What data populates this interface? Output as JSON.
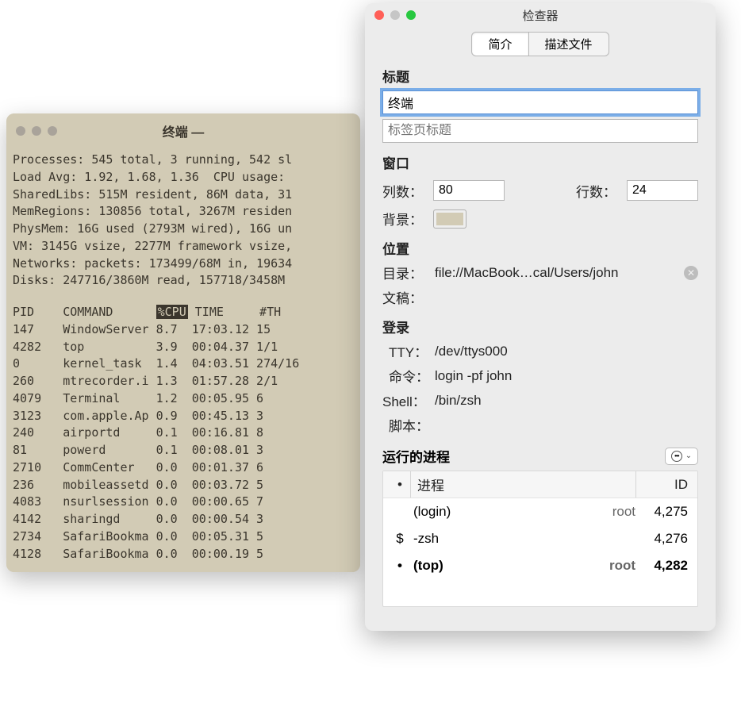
{
  "terminal": {
    "title": "终端 —",
    "stats": [
      "Processes: 545 total, 3 running, 542 sl",
      "Load Avg: 1.92, 1.68, 1.36  CPU usage: ",
      "SharedLibs: 515M resident, 86M data, 31",
      "MemRegions: 130856 total, 3267M residen",
      "PhysMem: 16G used (2793M wired), 16G un",
      "VM: 3145G vsize, 2277M framework vsize,",
      "Networks: packets: 173499/68M in, 19634",
      "Disks: 247716/3860M read, 157718/3458M "
    ],
    "columns": {
      "pid": "PID",
      "command": "COMMAND",
      "cpu": "%CPU",
      "time": "TIME",
      "th": "#TH"
    },
    "rows": [
      {
        "pid": "147",
        "cmd": "WindowServer",
        "cpu": "8.7",
        "time": "17:03.12",
        "th": "15"
      },
      {
        "pid": "4282",
        "cmd": "top",
        "cpu": "3.9",
        "time": "00:04.37",
        "th": "1/1"
      },
      {
        "pid": "0",
        "cmd": "kernel_task",
        "cpu": "1.4",
        "time": "04:03.51",
        "th": "274/16"
      },
      {
        "pid": "260",
        "cmd": "mtrecorder.i",
        "cpu": "1.3",
        "time": "01:57.28",
        "th": "2/1"
      },
      {
        "pid": "4079",
        "cmd": "Terminal",
        "cpu": "1.2",
        "time": "00:05.95",
        "th": "6"
      },
      {
        "pid": "3123",
        "cmd": "com.apple.Ap",
        "cpu": "0.9",
        "time": "00:45.13",
        "th": "3"
      },
      {
        "pid": "240",
        "cmd": "airportd",
        "cpu": "0.1",
        "time": "00:16.81",
        "th": "8"
      },
      {
        "pid": "81",
        "cmd": "powerd",
        "cpu": "0.1",
        "time": "00:08.01",
        "th": "3"
      },
      {
        "pid": "2710",
        "cmd": "CommCenter",
        "cpu": "0.0",
        "time": "00:01.37",
        "th": "6"
      },
      {
        "pid": "236",
        "cmd": "mobileassetd",
        "cpu": "0.0",
        "time": "00:03.72",
        "th": "5"
      },
      {
        "pid": "4083",
        "cmd": "nsurlsession",
        "cpu": "0.0",
        "time": "00:00.65",
        "th": "7"
      },
      {
        "pid": "4142",
        "cmd": "sharingd",
        "cpu": "0.0",
        "time": "00:00.54",
        "th": "3"
      },
      {
        "pid": "2734",
        "cmd": "SafariBookma",
        "cpu": "0.0",
        "time": "00:05.31",
        "th": "5"
      },
      {
        "pid": "4128",
        "cmd": "SafariBookma",
        "cpu": "0.0",
        "time": "00:00.19",
        "th": "5"
      }
    ]
  },
  "inspector": {
    "window_title": "检查器",
    "tabs": {
      "profile": "简介",
      "describe": "描述文件"
    },
    "title_section": {
      "label": "标题",
      "title_value": "终端",
      "tab_placeholder": "标签页标题"
    },
    "window_section": {
      "label": "窗口",
      "cols_label": "列数：",
      "cols_value": "80",
      "rows_label": "行数：",
      "rows_value": "24",
      "bg_label": "背景："
    },
    "location_section": {
      "label": "位置",
      "dir_label": "目录：",
      "dir_value": "file://MacBook…cal/Users/john",
      "doc_label": "文稿："
    },
    "login_section": {
      "label": "登录",
      "tty_label": "TTY：",
      "tty_value": "/dev/ttys000",
      "cmd_label": "命令：",
      "cmd_value": "login -pf john",
      "shell_label": "Shell：",
      "shell_value": "/bin/zsh",
      "script_label": "脚本："
    },
    "process_section": {
      "label": "运行的进程",
      "col_proc": "进程",
      "col_id": "ID",
      "rows": [
        {
          "glyph": "",
          "name": "(login)",
          "user": "root",
          "id": "4,275",
          "bold": false
        },
        {
          "glyph": "$",
          "name": "-zsh",
          "user": "",
          "id": "4,276",
          "bold": false
        },
        {
          "glyph": "•",
          "name": "(top)",
          "user": "root",
          "id": "4,282",
          "bold": true
        }
      ]
    }
  }
}
